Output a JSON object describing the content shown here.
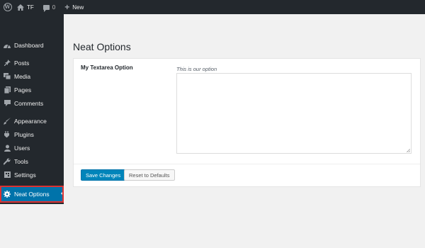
{
  "adminbar": {
    "site_name": "TF",
    "comment_count": "0",
    "new_label": "New"
  },
  "sidebar": {
    "items": [
      {
        "label": "Dashboard",
        "icon": "dashboard-icon"
      },
      {
        "label": "Posts",
        "icon": "pushpin-icon"
      },
      {
        "label": "Media",
        "icon": "media-icon"
      },
      {
        "label": "Pages",
        "icon": "pages-icon"
      },
      {
        "label": "Comments",
        "icon": "comment-icon"
      },
      {
        "label": "Appearance",
        "icon": "paintbrush-icon"
      },
      {
        "label": "Plugins",
        "icon": "plugin-icon"
      },
      {
        "label": "Users",
        "icon": "user-icon"
      },
      {
        "label": "Tools",
        "icon": "wrench-icon"
      },
      {
        "label": "Settings",
        "icon": "settings-icon"
      },
      {
        "label": "Neat Options",
        "icon": "gear-icon"
      }
    ]
  },
  "main": {
    "title": "Neat Options",
    "field_label": "My Textarea Option",
    "field_description": "This is our option",
    "textarea_value": "",
    "save_button": "Save Changes",
    "reset_button": "Reset to Defaults"
  },
  "colors": {
    "adminbar_bg": "#23282d",
    "sidebar_bg": "#23282d",
    "current_bg": "#0073aa",
    "primary_button": "#0085ba",
    "highlight_border": "#dc3232"
  }
}
